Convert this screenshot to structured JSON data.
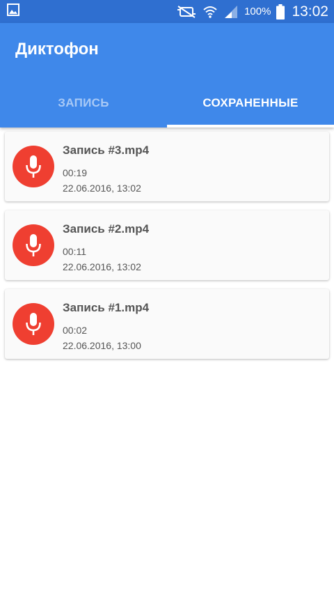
{
  "status_bar": {
    "battery_percent": "100%",
    "time": "13:02",
    "icons": [
      "gallery-icon",
      "mute-icon",
      "wifi-icon",
      "signal-icon",
      "battery-icon"
    ]
  },
  "app": {
    "title": "Диктофон",
    "primary_color": "#3f88ea",
    "accent_color": "#ef3f31"
  },
  "tabs": [
    {
      "label": "ЗАПИСЬ",
      "selected": false
    },
    {
      "label": "СОХРАНЕННЫЕ",
      "selected": true
    }
  ],
  "recordings": [
    {
      "name": "Запись #3.mp4",
      "duration": "00:19",
      "date": "22.06.2016, 13:02",
      "icon": "microphone-icon"
    },
    {
      "name": "Запись #2.mp4",
      "duration": "00:11",
      "date": "22.06.2016, 13:02",
      "icon": "microphone-icon"
    },
    {
      "name": "Запись #1.mp4",
      "duration": "00:02",
      "date": "22.06.2016, 13:00",
      "icon": "microphone-icon"
    }
  ]
}
